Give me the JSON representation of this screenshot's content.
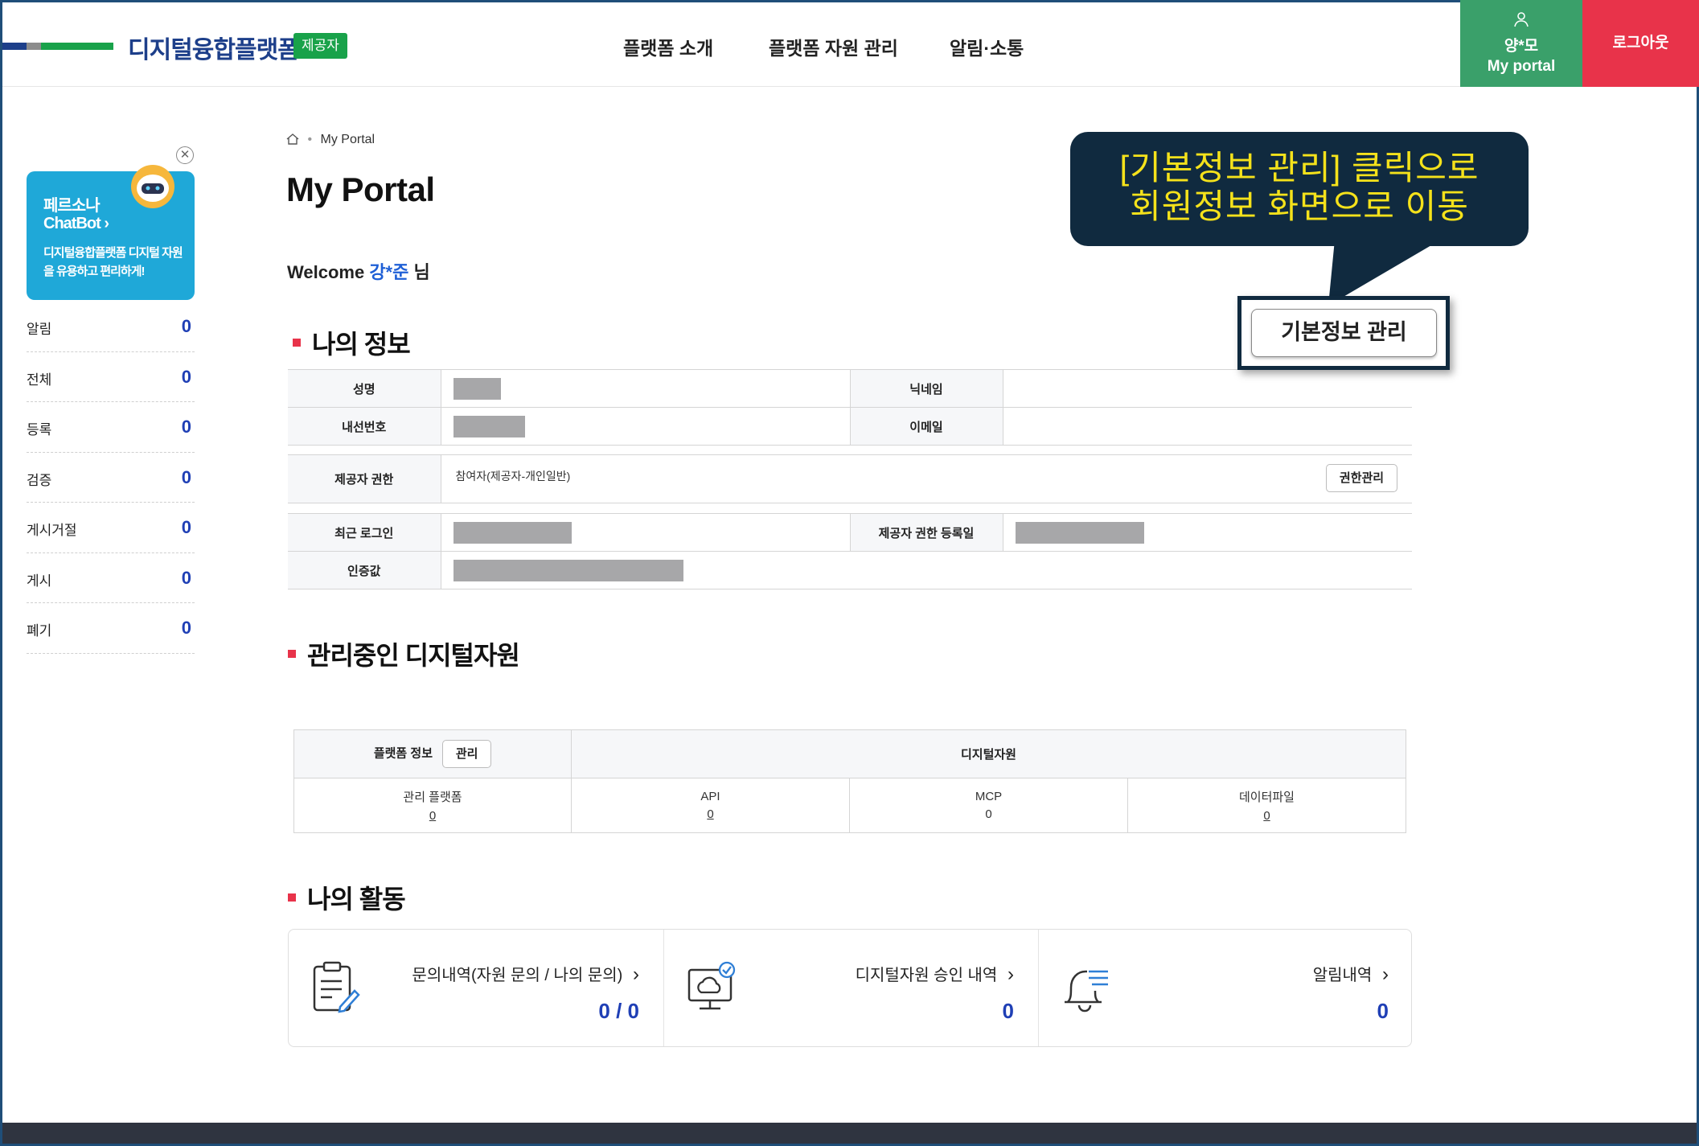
{
  "header": {
    "logo_text": "디지털융합플랫폼",
    "logo_badge": "제공자",
    "colors": {
      "brand_navy": "#1d3f8a",
      "brand_green": "#19a24a",
      "portal_bg": "#3aa06a",
      "logout_bg": "#e8334a"
    },
    "nav": [
      "플랫폼 소개",
      "플랫폼 자원 관리",
      "알림·소통"
    ],
    "user_name": "양*모",
    "portal_label": "My portal",
    "logout_label": "로그아웃"
  },
  "sidebar": {
    "chatbot": {
      "line1": "페르소나",
      "line2": "ChatBot",
      "desc": "디지털융합플랫폼 디지털 자원을 유용하고 편리하게!",
      "close_glyph": "✕"
    },
    "items": [
      {
        "label": "알림",
        "value": "0"
      },
      {
        "label": "전체",
        "value": "0"
      },
      {
        "label": "등록",
        "value": "0"
      },
      {
        "label": "검증",
        "value": "0"
      },
      {
        "label": "게시거절",
        "value": "0"
      },
      {
        "label": "게시",
        "value": "0"
      },
      {
        "label": "폐기",
        "value": "0"
      }
    ]
  },
  "breadcrumb": {
    "current": "My Portal"
  },
  "page_title": "My Portal",
  "welcome": {
    "prefix": "Welcome",
    "name": "강*준",
    "suffix": "님"
  },
  "my_info": {
    "title": "나의 정보",
    "manage_button": "기본정보 관리",
    "labels": {
      "name": "성명",
      "nickname": "닉네임",
      "ext": "내선번호",
      "email": "이메일",
      "provider_auth": "제공자 권한",
      "last_login": "최근 로그인",
      "auth_reg_date": "제공자 권한 등록일",
      "cert": "인증값"
    },
    "provider_auth_value": "참여자(제공자-개인일반)",
    "auth_manage_button": "권한관리"
  },
  "managed": {
    "title": "관리중인 디지털자원",
    "platform_info": "플랫폼 정보",
    "manage_btn": "관리",
    "digital_resource": "디지털자원",
    "cols": [
      {
        "label": "관리 플랫폼",
        "value": "0"
      },
      {
        "label": "API",
        "value": "0"
      },
      {
        "label": "MCP",
        "value": "0"
      },
      {
        "label": "데이터파일",
        "value": "0"
      }
    ]
  },
  "activity": {
    "title": "나의 활동",
    "items": [
      {
        "label": "문의내역(자원 문의 / 나의 문의)",
        "value": "0 / 0",
        "icon": "clipboard-edit-icon"
      },
      {
        "label": "디지털자원 승인 내역",
        "value": "0",
        "icon": "monitor-cloud-icon"
      },
      {
        "label": "알림내역",
        "value": "0",
        "icon": "bell-icon"
      }
    ]
  },
  "annotation": {
    "line1": "[기본정보 관리] 클릭으로",
    "line2": "회원정보 화면으로 이동"
  }
}
